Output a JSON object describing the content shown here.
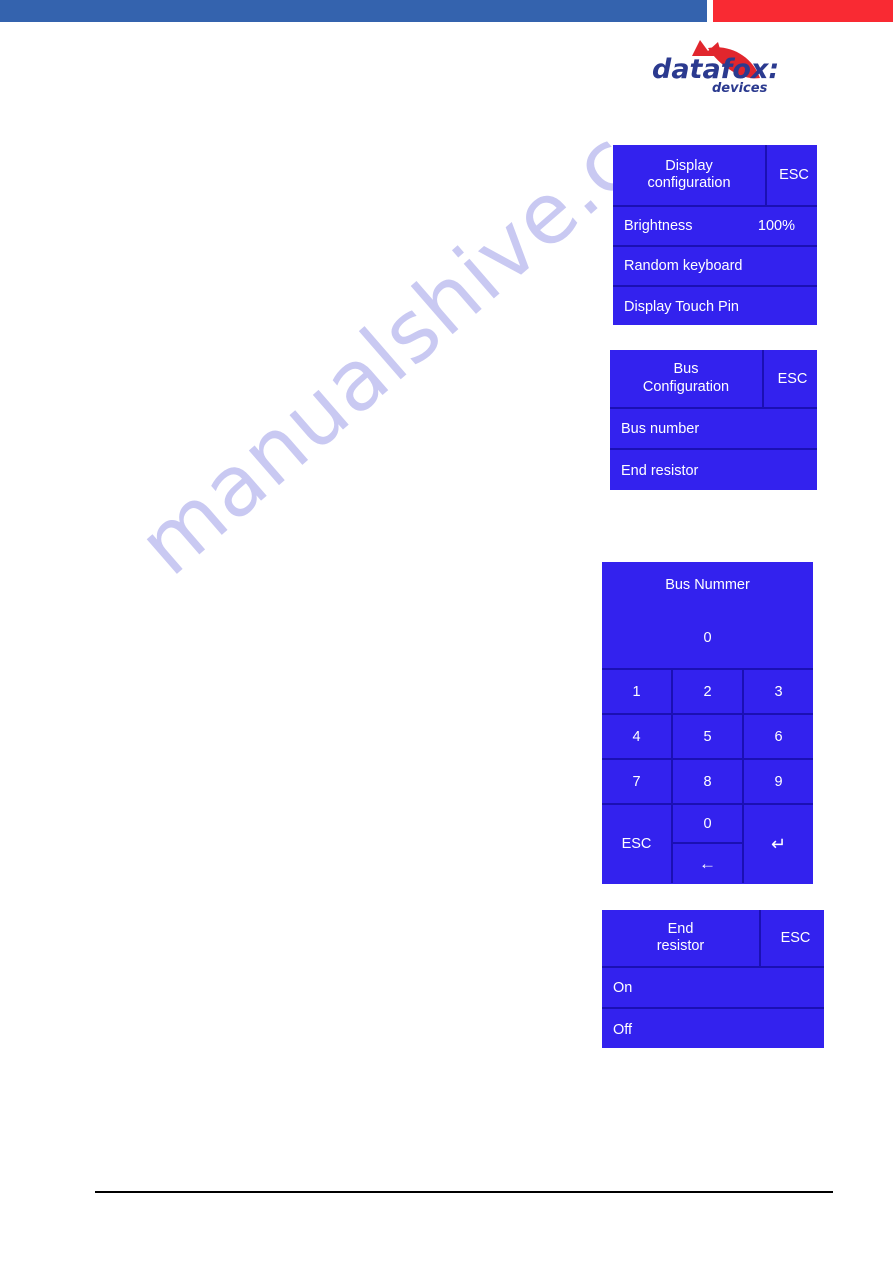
{
  "header": {
    "bar_blue_color": "#3463ae",
    "bar_red_color": "#f92a33"
  },
  "logo": {
    "word_primary": "datafox:",
    "word_secondary": "devices",
    "text_color": "#2b3a8f",
    "mark_color": "#e1262d"
  },
  "watermark": {
    "text": "manualshive.c",
    "color": "#c9c9f2"
  },
  "theme": {
    "screen_background": "#3322ee",
    "screen_divider": "#1b10b4",
    "screen_text": "#ffffff"
  },
  "panels": {
    "display_configuration": {
      "title_line1": "Display",
      "title_line2": "configuration",
      "esc_label": "ESC",
      "rows": [
        {
          "label": "Brightness",
          "value": "100%"
        },
        {
          "label": "Random keyboard",
          "value": ""
        },
        {
          "label": "Display Touch Pin",
          "value": ""
        }
      ]
    },
    "bus_configuration": {
      "title_line1": "Bus",
      "title_line2": "Configuration",
      "esc_label": "ESC",
      "rows": [
        {
          "label": "Bus number",
          "value": ""
        },
        {
          "label": "End resistor",
          "value": ""
        }
      ]
    },
    "bus_number_keypad": {
      "title": "Bus Nummer",
      "value": "0",
      "keys": [
        "1",
        "2",
        "3",
        "4",
        "5",
        "6",
        "7",
        "8",
        "9"
      ],
      "esc_label": "ESC",
      "zero_label": "0",
      "backspace_glyph": "←",
      "enter_glyph": "↵"
    },
    "end_resistor": {
      "title_line1": "End",
      "title_line2": "resistor",
      "esc_label": "ESC",
      "rows": [
        {
          "label": "On",
          "value": ""
        },
        {
          "label": "Off",
          "value": ""
        }
      ]
    }
  }
}
